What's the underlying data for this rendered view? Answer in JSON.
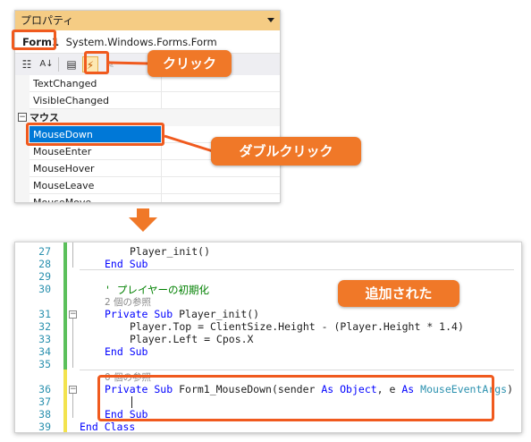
{
  "properties_panel": {
    "title": "プロパティ",
    "object_name": "Form1",
    "object_type": "System.Windows.Forms.Form",
    "toolbar": {
      "categorized_icon": "categorized-icon",
      "alphabetical_icon": "alphabetical-icon",
      "properties_icon": "properties-icon",
      "events_icon": "lightning-icon",
      "property_pages_icon": "wrench-icon"
    },
    "rows": [
      {
        "label": "TextChanged"
      },
      {
        "label": "VisibleChanged"
      },
      {
        "category": "マウス",
        "toggle": "⊟"
      },
      {
        "label": "MouseDown",
        "selected": true
      },
      {
        "label": "MouseEnter"
      },
      {
        "label": "MouseHover"
      },
      {
        "label": "MouseLeave"
      },
      {
        "label": "MouseMove"
      }
    ]
  },
  "callouts": {
    "click": "クリック",
    "double_click": "ダブルクリック",
    "added": "追加された"
  },
  "editor": {
    "line_numbers": [
      "27",
      "28",
      "29",
      "30",
      "",
      "31",
      "32",
      "33",
      "34",
      "35",
      "",
      "36",
      "37",
      "38",
      "39"
    ],
    "lines": {
      "l27": "Player_init()",
      "l28": "End Sub",
      "l30": "' プレイヤーの初期化",
      "ref_a": "2 個の参照",
      "l31_kw": "Private Sub",
      "l31_name": " Player_init()",
      "l32": "Player.Top = ClientSize.Height - (Player.Height * 1.4)",
      "l33": "Player.Left = Cpos.X",
      "l34": "End Sub",
      "ref_b": "0 個の参照",
      "l36_kw1": "Private Sub",
      "l36_name": " Form1_MouseDown(sender ",
      "l36_kw2": "As",
      "l36_type1": " Object",
      "l36_mid": ", e ",
      "l36_kw3": "As",
      "l36_type2": " MouseEventArgs",
      "l36_end": ")",
      "l38": "End Sub",
      "l39": "End Class"
    }
  },
  "colors": {
    "accent": "#f07828",
    "selection": "#0078d7",
    "keyword": "#0000ff",
    "type": "#2b91af",
    "comment": "#008000"
  }
}
